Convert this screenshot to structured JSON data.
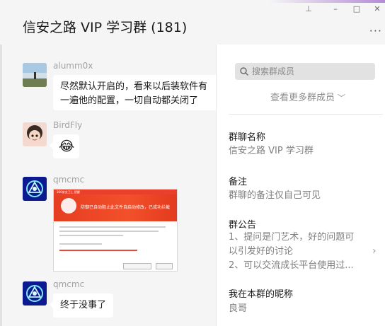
{
  "window": {
    "title": "信安之路 VIP 学习群 (181)",
    "controls": {
      "pin": "⊥",
      "minimize": "–",
      "maximize": "□",
      "close": "✕"
    },
    "more": "···"
  },
  "messages": [
    {
      "sender": "alumm0x",
      "lines": [
        "尽然默认开启的，看来以后装软件有",
        "一遍他的配置，一切自动都关闭了"
      ]
    },
    {
      "sender": "BirdFly",
      "emoji": "😂"
    },
    {
      "sender": "qmcmc",
      "image": {
        "titlebar": "360安全卫士 提醒",
        "heading": "防御已自动阻止此文件自启动修改，已成功拦截"
      }
    },
    {
      "sender": "qmcmc",
      "text": "终于没事了"
    }
  ],
  "members_panel": {
    "search_placeholder": "搜索群成员",
    "view_more": "查看更多群成员",
    "sections": [
      {
        "title": "群聊名称",
        "value": "信安之路 VIP 学习群"
      },
      {
        "title": "备注",
        "value": "群聊的备注仅自己可见"
      },
      {
        "title": "群公告",
        "lines": [
          "1、提问是门艺术，好的问题可",
          "以引发好的讨论",
          "2、可以交流成长平台使用过..."
        ]
      },
      {
        "title": "我在本群的昵称",
        "value": "良哥"
      }
    ]
  },
  "colors": {
    "accent": "#b48ad8",
    "avatar_blue": "#0b1b8f",
    "warning_red": "#e8402a"
  }
}
